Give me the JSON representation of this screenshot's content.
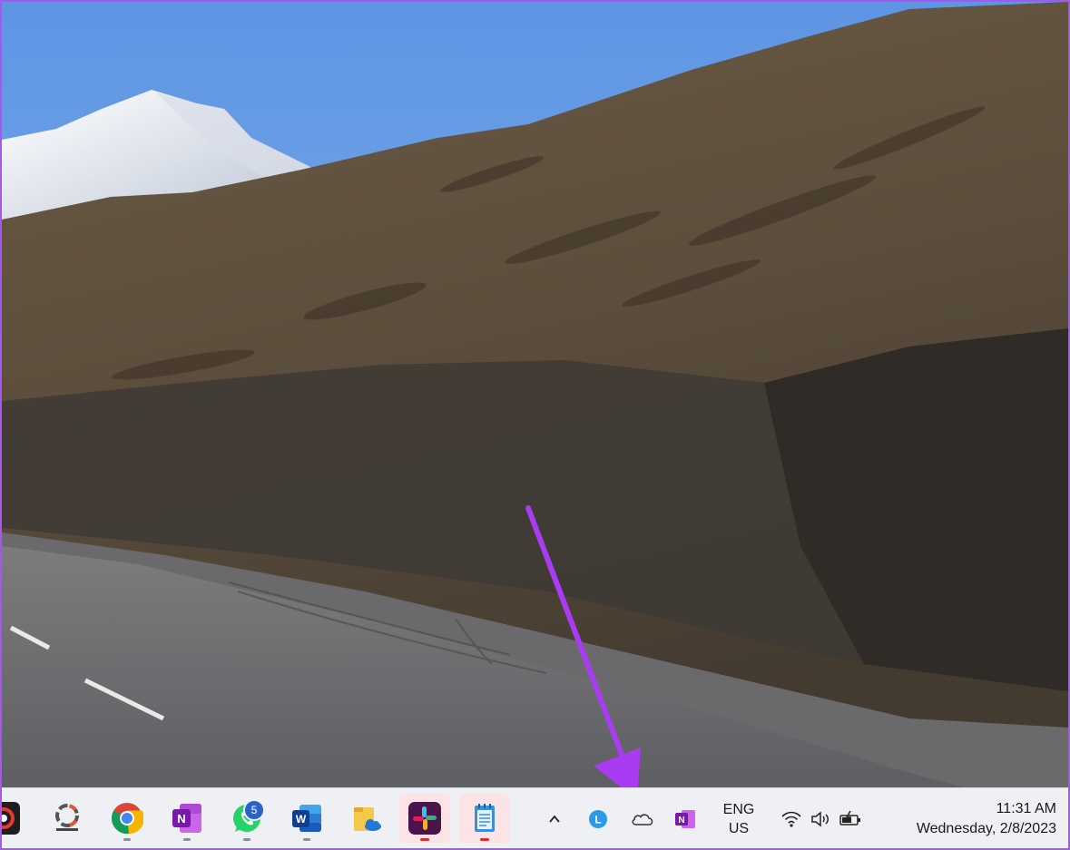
{
  "taskbar": {
    "apps": [
      {
        "name": "recording-app",
        "icon": "record-icon"
      },
      {
        "name": "photoscape",
        "icon": "photoscape-icon"
      },
      {
        "name": "chrome",
        "icon": "chrome-icon"
      },
      {
        "name": "onenote",
        "icon": "onenote-icon"
      },
      {
        "name": "whatsapp",
        "icon": "whatsapp-icon",
        "badge": "5"
      },
      {
        "name": "word",
        "icon": "word-icon"
      },
      {
        "name": "file-explorer",
        "icon": "folder-cloud-icon"
      },
      {
        "name": "slack",
        "icon": "slack-icon"
      },
      {
        "name": "notepad",
        "icon": "notepad-icon"
      }
    ],
    "tray": {
      "language": "ENG",
      "region": "US",
      "time": "11:31 AM",
      "date": "Wednesday, 2/8/2023"
    }
  },
  "colors": {
    "frame_border": "#a955f0",
    "arrow": "#a93cf2",
    "taskbar_bg": "#eef0f4",
    "active_app_bg": "#fbe3e6",
    "indicator_red": "#d32f2f"
  }
}
